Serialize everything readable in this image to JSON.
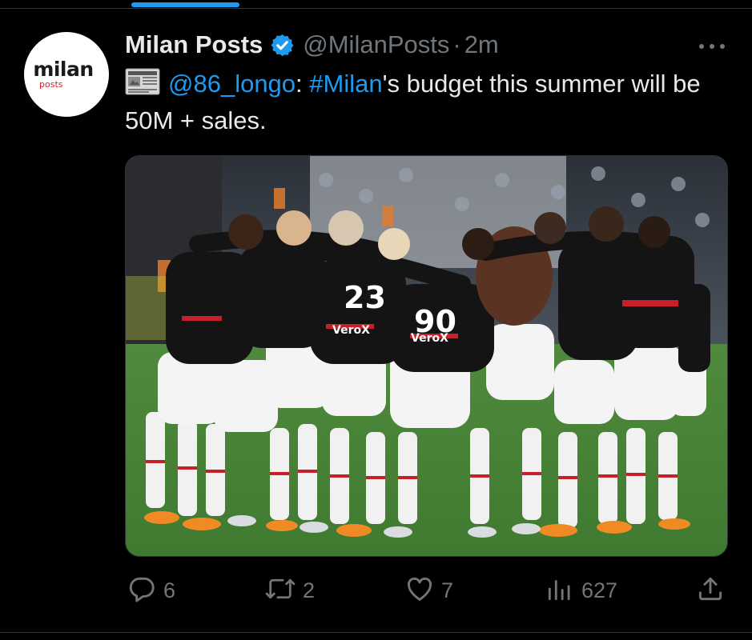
{
  "tweet": {
    "avatar": {
      "brand": "milan",
      "brand_sub": "posts"
    },
    "author": {
      "display_name": "Milan Posts",
      "handle": "@MilanPosts",
      "separator": "·",
      "time": "2m"
    },
    "text": {
      "mention": "@86_longo",
      "after_mention": ": ",
      "hashtag": "#Milan",
      "rest": "'s budget this summer will be 50M + sales."
    },
    "photo": {
      "jersey_numbers": [
        "23",
        "90"
      ],
      "sponsor": "VeroX"
    },
    "actions": {
      "replies": "6",
      "reposts": "2",
      "likes": "7",
      "views": "627"
    }
  },
  "colors": {
    "accent": "#1d9bf0",
    "muted": "#71767b",
    "text": "#e7e9ea",
    "background": "#000000"
  },
  "icons": [
    "verified-badge-icon",
    "newspaper-emoji-icon",
    "more-icon",
    "reply-icon",
    "repost-icon",
    "like-icon",
    "views-icon",
    "share-icon"
  ]
}
